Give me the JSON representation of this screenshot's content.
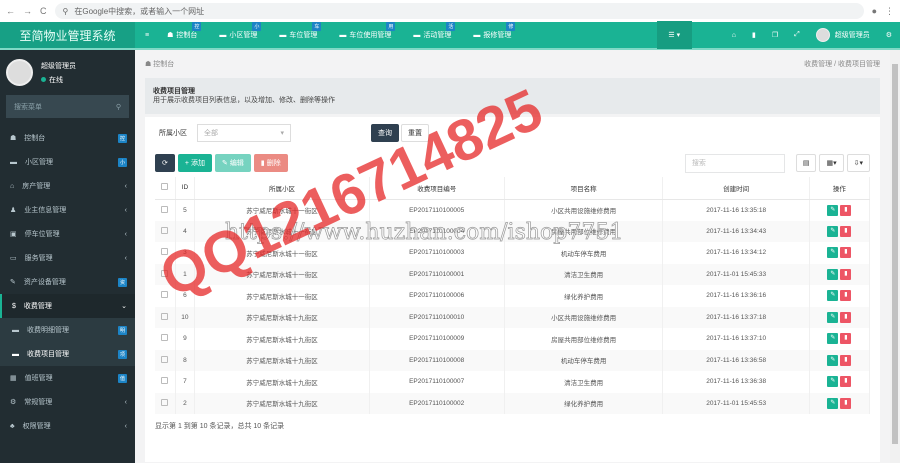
{
  "browser": {
    "address_placeholder": "在Google中搜索，或者输入一个网址"
  },
  "app": {
    "title": "至简物业管理系统"
  },
  "topnav": [
    {
      "label": "控制台",
      "badge": "控"
    },
    {
      "label": "小区管理",
      "badge": "小"
    },
    {
      "label": "车位管理",
      "badge": "车"
    },
    {
      "label": "车位使用管理",
      "badge": "用"
    },
    {
      "label": "活动管理",
      "badge": "活"
    },
    {
      "label": "报修管理",
      "badge": "修"
    }
  ],
  "header_user": "超级管理员",
  "sidebar": {
    "user": "超级管理员",
    "status": "在线",
    "search_placeholder": "搜索菜单",
    "items": [
      {
        "label": "控制台",
        "badge": "控"
      },
      {
        "label": "小区管理",
        "badge": "小"
      },
      {
        "label": "房产管理"
      },
      {
        "label": "业主信息管理"
      },
      {
        "label": "停车位管理"
      },
      {
        "label": "服务管理"
      },
      {
        "label": "资产设备管理",
        "badge": "资"
      },
      {
        "label": "收费管理"
      },
      {
        "label": "收费明细管理",
        "badge": "明"
      },
      {
        "label": "收费项目管理",
        "badge": "项"
      },
      {
        "label": "值班管理",
        "badge": "值"
      },
      {
        "label": "常规管理"
      },
      {
        "label": "权限管理"
      }
    ]
  },
  "breadcrumb": {
    "home": "控制台",
    "parent": "收费管理",
    "current": "收费项目管理"
  },
  "page": {
    "title": "收费项目管理",
    "desc": "用于展示收费项目列表信息，以及增加、修改、删除等操作"
  },
  "filter": {
    "label": "所属小区",
    "value": "全部",
    "query": "查询",
    "reset": "重置"
  },
  "toolbar": {
    "add": "添加",
    "edit": "编辑",
    "delete": "删除",
    "search_placeholder": "搜索"
  },
  "table": {
    "headers": [
      "ID",
      "所属小区",
      "收费项目编号",
      "项目名称",
      "创建时间",
      "操作"
    ],
    "rows": [
      [
        "5",
        "苏宁威尼斯水城十一街区",
        "EP2017110100005",
        "小区共用设施维修费用",
        "2017-11-16 13:35:18"
      ],
      [
        "4",
        "苏宁威尼斯水城十一街区",
        "EP2017110100004",
        "房屋共用部位维修费用",
        "2017-11-16 13:34:43"
      ],
      [
        "3",
        "苏宁威尼斯水城十一街区",
        "EP2017110100003",
        "机动车停车费用",
        "2017-11-16 13:34:12"
      ],
      [
        "1",
        "苏宁威尼斯水城十一街区",
        "EP2017110100001",
        "清洁卫生费用",
        "2017-11-01 15:45:33"
      ],
      [
        "6",
        "苏宁威尼斯水城十一街区",
        "EP2017110100006",
        "绿化养护费用",
        "2017-11-16 13:36:16"
      ],
      [
        "10",
        "苏宁威尼斯水城十九街区",
        "EP2017110100010",
        "小区共用设施维修费用",
        "2017-11-16 13:37:18"
      ],
      [
        "9",
        "苏宁威尼斯水城十九街区",
        "EP2017110100009",
        "房屋共用部位维修费用",
        "2017-11-16 13:37:10"
      ],
      [
        "8",
        "苏宁威尼斯水城十九街区",
        "EP2017110100008",
        "机动车停车费用",
        "2017-11-16 13:36:58"
      ],
      [
        "7",
        "苏宁威尼斯水城十九街区",
        "EP2017110100007",
        "清洁卫生费用",
        "2017-11-16 13:36:38"
      ],
      [
        "2",
        "苏宁威尼斯水城十九街区",
        "EP2017110100002",
        "绿化养护费用",
        "2017-11-01 15:45:53"
      ]
    ]
  },
  "pagination": "显示第 1 到第 10 条记录，总共 10 条记录",
  "watermark": {
    "qq": "QQ1216714825",
    "url": "https://www.huzhan.com/ishop7751"
  }
}
